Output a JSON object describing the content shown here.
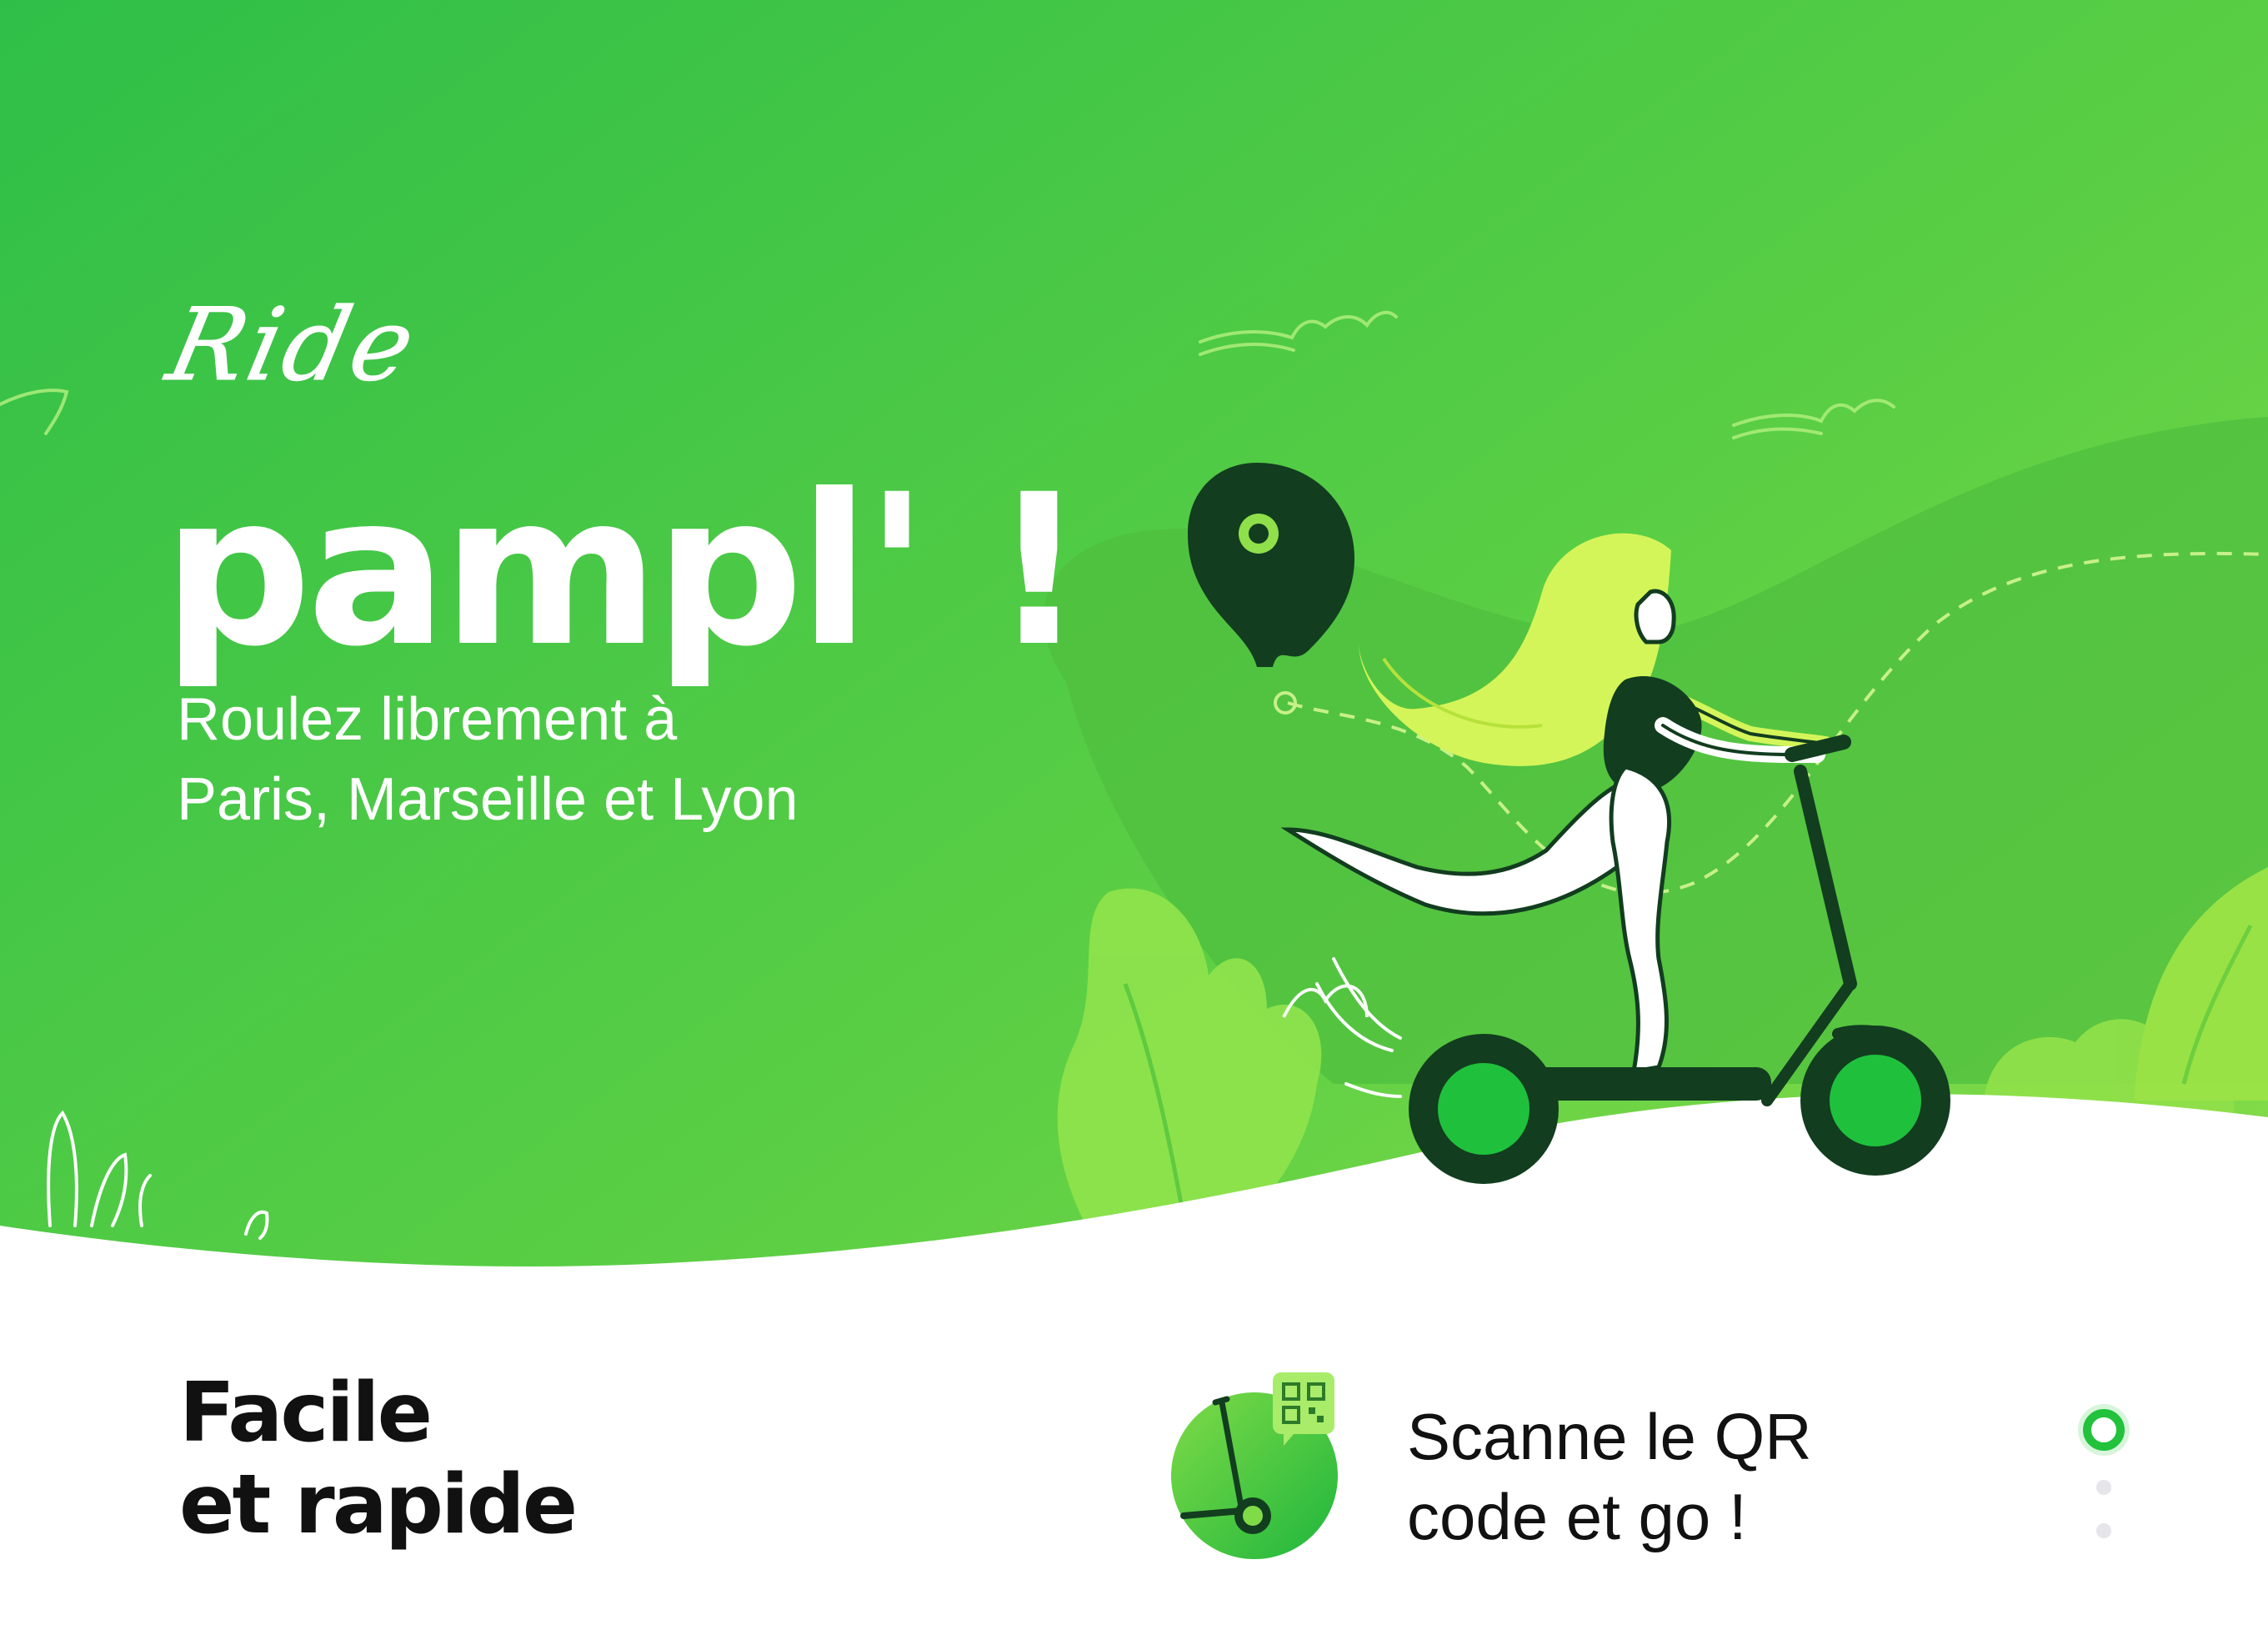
{
  "hero": {
    "script_word": "Ride",
    "brand": "pampl' !",
    "tagline_line1": "Roulez librement à",
    "tagline_line2": "Paris, Marseille et Lyon"
  },
  "feature": {
    "title_line1": "Facile",
    "title_line2": "et rapide",
    "step_text_line1": "Scanne le QR",
    "step_text_line2": "code et go !"
  },
  "carousel": {
    "active_index": 0,
    "total": 3
  },
  "colors": {
    "primary_green": "#3cc43f",
    "light_green": "#8fe04a",
    "dark_green": "#123d1f",
    "hair_yellow_green": "#d4f55a",
    "wheel_green": "#1fc13c"
  },
  "icons": [
    "location-pin-icon",
    "qr-code-icon",
    "scooter-icon"
  ]
}
